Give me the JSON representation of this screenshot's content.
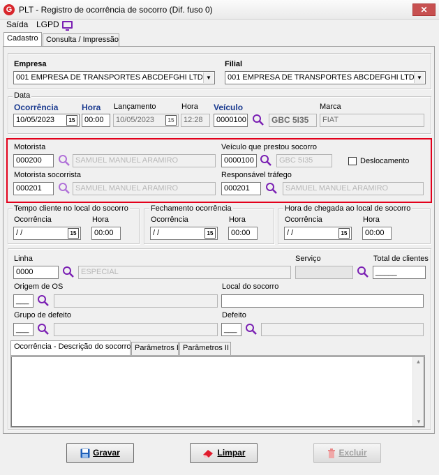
{
  "window": {
    "title": "PLT - Registro de ocorrência de socorro (Dif. fuso 0)",
    "close": "✕"
  },
  "menu": {
    "saida": "Saída",
    "lgpd": "LGPD"
  },
  "tabs": {
    "cadastro": "Cadastro",
    "consulta": "Consulta / Impressão"
  },
  "empresa": {
    "label": "Empresa",
    "value": "001 EMPRESA DE TRANSPORTES ABCDEFGHI LTD"
  },
  "filial": {
    "label": "Filial",
    "value": "001 EMPRESA DE TRANSPORTES ABCDEFGHI LTD"
  },
  "data": {
    "legend": "Data",
    "ocorrencia_label": "Ocorrência",
    "ocorrencia_value": "10/05/2023",
    "hora_label": "Hora",
    "hora_value": "00:00",
    "lancamento_label": "Lançamento",
    "lancamento_value": "10/05/2023",
    "hora2_label": "Hora",
    "hora2_value": "12:28",
    "veiculo_label": "Veículo",
    "veiculo_value": "0000100",
    "placa_value": "GBC 5I35",
    "marca_label": "Marca",
    "marca_value": "FIAT",
    "cal_glyph": "15"
  },
  "motorista": {
    "label": "Motorista",
    "code": "000200",
    "name": "SAMUEL MANUEL ARAMIRO",
    "socorrista_label": "Motorista socorrista",
    "socorrista_code": "000201",
    "socorrista_name": "SAMUEL MANUEL ARAMIRO"
  },
  "veiculo_socorro": {
    "label": "Veículo que prestou socorro",
    "code": "0000100",
    "plate": "GBC 5I35",
    "deslocamento_label": "Deslocamento",
    "responsavel_label": "Responsável tráfego",
    "responsavel_code": "000201",
    "responsavel_name": "SAMUEL MANUEL ARAMIRO"
  },
  "tempo_cliente": {
    "legend": "Tempo cliente no local do socorro",
    "ocorrencia_label": "Ocorrência",
    "ocorrencia_value": " / /",
    "hora_label": "Hora",
    "hora_value": "00:00"
  },
  "fechamento": {
    "legend": "Fechamento ocorrência",
    "ocorrencia_label": "Ocorrência",
    "ocorrencia_value": " / /",
    "hora_label": "Hora",
    "hora_value": "00:00"
  },
  "chegada": {
    "legend": "Hora de chegada ao local de socorro",
    "ocorrencia_label": "Ocorrência",
    "ocorrencia_value": " / /",
    "hora_label": "Hora",
    "hora_value": "00:00"
  },
  "linha": {
    "label": "Linha",
    "code": "0000",
    "desc": "ESPECIAL"
  },
  "servico": {
    "label": "Serviço",
    "value": ""
  },
  "total_clientes": {
    "label": "Total de clientes",
    "value": "_____"
  },
  "origem": {
    "label": "Origem de OS",
    "code": "___",
    "desc": ""
  },
  "local": {
    "label": "Local do socorro",
    "value": ""
  },
  "grupo": {
    "label": "Grupo de defeito",
    "code": "___",
    "desc": ""
  },
  "defeito": {
    "label": "Defeito",
    "code": "___",
    "desc": ""
  },
  "subtabs": {
    "descricao": "Ocorrência - Descrição do socorro",
    "param1": "Parâmetros I",
    "param2": "Parâmetros II"
  },
  "memo": {
    "value": ""
  },
  "buttons": {
    "gravar": "Gravar",
    "limpar": "Limpar",
    "excluir": "Excluir"
  },
  "colors": {
    "accent_purple": "#7a1fb3",
    "highlight_red": "#e3001b",
    "label_blue": "#1a3a8f"
  }
}
